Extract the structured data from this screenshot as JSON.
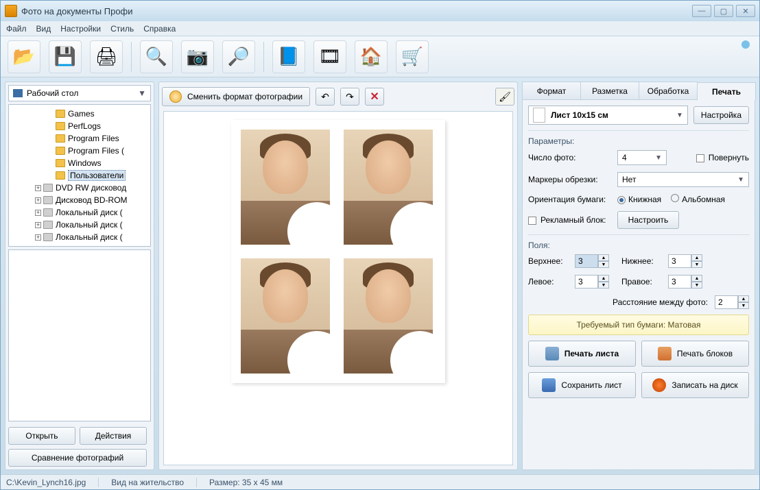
{
  "window": {
    "title": "Фото на документы Профи",
    "buttons": {
      "min": "—",
      "max": "▢",
      "close": "✕"
    }
  },
  "menu": [
    "Файл",
    "Вид",
    "Настройки",
    "Стиль",
    "Справка"
  ],
  "toolbarIcons": [
    "📂",
    "💾",
    "🖨",
    "🔍",
    "📷",
    "🔎",
    "📘",
    "🎞",
    "🏠",
    "🛒"
  ],
  "left": {
    "combo": "Рабочий стол",
    "tree": [
      {
        "label": "Games",
        "type": "folder",
        "deep": true
      },
      {
        "label": "PerfLogs",
        "type": "folder",
        "deep": true
      },
      {
        "label": "Program Files",
        "type": "folder",
        "deep": true
      },
      {
        "label": "Program Files (",
        "type": "folder",
        "deep": true
      },
      {
        "label": "Windows",
        "type": "folder",
        "deep": true
      },
      {
        "label": "Пользователи",
        "type": "folder",
        "deep": true,
        "selected": true
      },
      {
        "label": "DVD RW дисковод",
        "type": "drive",
        "exp": true
      },
      {
        "label": "Дисковод BD-ROM",
        "type": "drive",
        "exp": true
      },
      {
        "label": "Локальный диск (",
        "type": "drive",
        "exp": true
      },
      {
        "label": "Локальный диск (",
        "type": "drive",
        "exp": true
      },
      {
        "label": "Локальный диск (",
        "type": "drive",
        "exp": true
      }
    ],
    "btnOpen": "Открыть",
    "btnActions": "Действия",
    "btnCompare": "Сравнение фотографий"
  },
  "center": {
    "changeFormat": "Сменить формат фотографии"
  },
  "right": {
    "tabs": [
      "Формат",
      "Разметка",
      "Обработка",
      "Печать"
    ],
    "activeTab": 3,
    "paper": "Лист 10х15 см",
    "btnSetup": "Настройка",
    "sectionParams": "Параметры:",
    "photoCountLabel": "Число фото:",
    "photoCount": "4",
    "rotateLabel": "Повернуть",
    "cropMarkersLabel": "Маркеры обрезки:",
    "cropMarkers": "Нет",
    "orientationLabel": "Ориентация бумаги:",
    "orientPortrait": "Книжная",
    "orientLandscape": "Альбомная",
    "adBlockLabel": "Рекламный блок:",
    "btnConfigure": "Настроить",
    "sectionMargins": "Поля:",
    "marginTop": {
      "label": "Верхнее:",
      "value": "3"
    },
    "marginBottom": {
      "label": "Нижнее:",
      "value": "3"
    },
    "marginLeft": {
      "label": "Левое:",
      "value": "3"
    },
    "marginRight": {
      "label": "Правое:",
      "value": "3"
    },
    "spacingLabel": "Расстояние между фото:",
    "spacing": "2",
    "paperReq": "Требуемый тип бумаги: Матовая",
    "btnPrintSheet": "Печать листа",
    "btnPrintBlocks": "Печать блоков",
    "btnSaveSheet": "Сохранить лист",
    "btnBurn": "Записать на диск"
  },
  "status": {
    "file": "C:\\Kevin_Lynch16.jpg",
    "mode": "Вид на жительство",
    "size": "Размер: 35 x 45 мм"
  }
}
